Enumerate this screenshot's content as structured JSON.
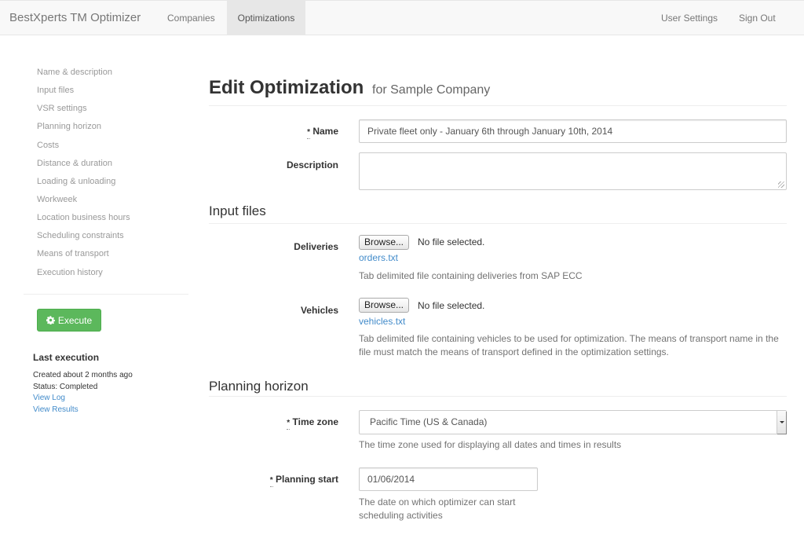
{
  "navbar": {
    "brand": "BestXperts TM Optimizer",
    "left_links": [
      "Companies",
      "Optimizations"
    ],
    "active": "Optimizations",
    "right_links": [
      "User Settings",
      "Sign Out"
    ]
  },
  "sidebar": {
    "items": [
      "Name & description",
      "Input files",
      "VSR settings",
      "Planning horizon",
      "Costs",
      "Distance & duration",
      "Loading & unloading",
      "Workweek",
      "Location business hours",
      "Scheduling constraints",
      "Means of transport",
      "Execution history"
    ],
    "execute_label": "Execute",
    "execute_icon": "gear-icon",
    "last_execution": {
      "title": "Last execution",
      "created": "Created about 2 months ago",
      "status": "Status: Completed",
      "view_log": "View Log",
      "view_results": "View Results"
    }
  },
  "main": {
    "title": "Edit Optimization",
    "subtitle": "for Sample Company",
    "required_marker": "*",
    "name": {
      "label": "Name",
      "value": "Private fleet only - January 6th through January 10th, 2014"
    },
    "description": {
      "label": "Description",
      "value": ""
    },
    "input_files": {
      "title": "Input files",
      "deliveries": {
        "label": "Deliveries",
        "browse": "Browse...",
        "status": "No file selected.",
        "file": "orders.txt",
        "help": "Tab delimited file containing deliveries from SAP ECC"
      },
      "vehicles": {
        "label": "Vehicles",
        "browse": "Browse...",
        "status": "No file selected.",
        "file": "vehicles.txt",
        "help": "Tab delimited file containing vehicles to be used for optimization. The means of transport name in the file must match the means of transport defined in the optimization settings."
      }
    },
    "planning_horizon": {
      "title": "Planning horizon",
      "time_zone": {
        "label": "Time zone",
        "value": "Pacific Time (US & Canada)",
        "help": "The time zone used for displaying all dates and times in results"
      },
      "planning_start": {
        "label": "Planning start",
        "value": "01/06/2014",
        "help": "The date on which optimizer can start scheduling activities"
      }
    }
  }
}
